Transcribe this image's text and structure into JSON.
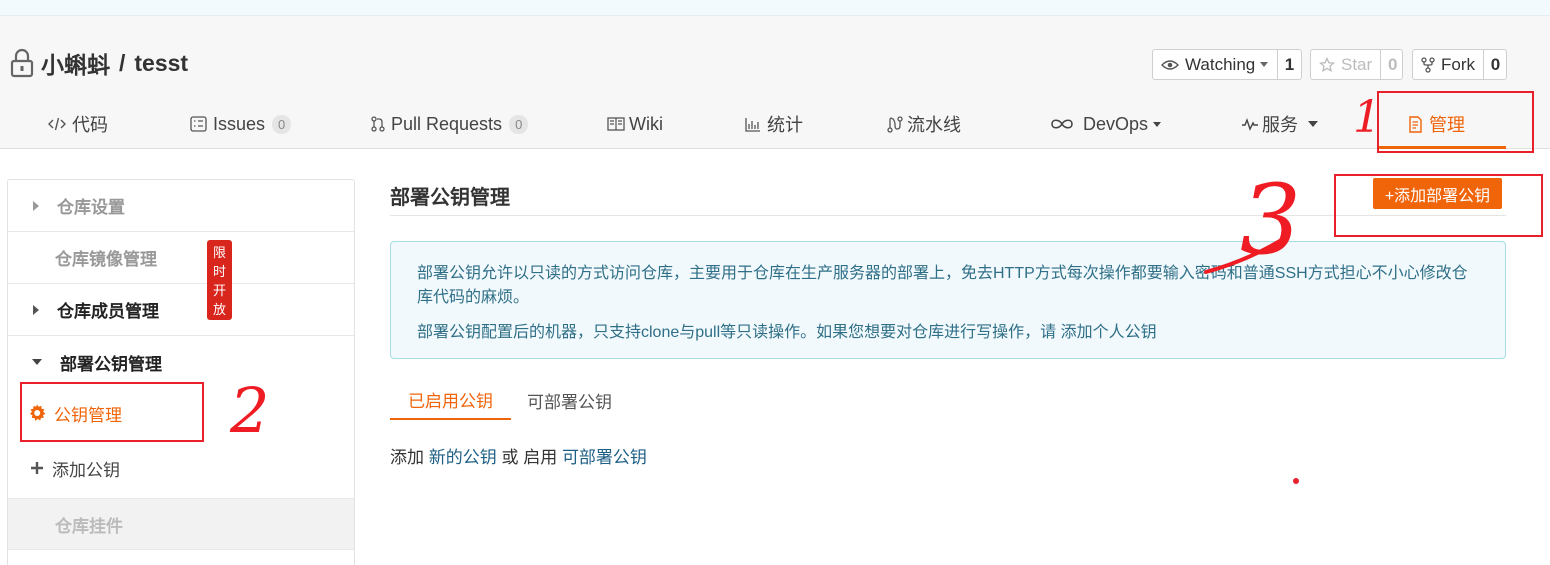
{
  "repo": {
    "owner": "小蝌蚪",
    "separator": "/",
    "name": "tesst"
  },
  "actions": {
    "watch": {
      "label": "Watching",
      "count": "1"
    },
    "star": {
      "label": "Star",
      "count": "0"
    },
    "fork": {
      "label": "Fork",
      "count": "0"
    }
  },
  "tabs": [
    {
      "label": "代码",
      "icon": "code-icon"
    },
    {
      "label": "Issues",
      "badge": "0",
      "icon": "issues-icon"
    },
    {
      "label": "Pull Requests",
      "badge": "0",
      "icon": "pull-request-icon"
    },
    {
      "label": "Wiki",
      "icon": "book-icon"
    },
    {
      "label": "统计",
      "icon": "bar-chart-icon"
    },
    {
      "label": "流水线",
      "icon": "pipeline-icon"
    },
    {
      "label": "DevOps",
      "icon": "infinity-icon"
    },
    {
      "label": "服务",
      "icon": "pulse-icon"
    },
    {
      "label": "管理",
      "icon": "manage-icon",
      "active": true
    }
  ],
  "sidebar": {
    "repo_settings": "仓库设置",
    "mirror_manage": "仓库镜像管理",
    "limit_badge": "限时开放",
    "member_manage": "仓库成员管理",
    "deploy_key_manage": "部署公钥管理",
    "key_manage": "公钥管理",
    "add_key": "添加公钥",
    "repo_plugins": "仓库挂件"
  },
  "main": {
    "title": "部署公钥管理",
    "add_button": "+添加部署公钥",
    "info_line1": "部署公钥允许以只读的方式访问仓库，主要用于仓库在生产服务器的部署上，免去HTTP方式每次操作都要输入密码和普通SSH方式担心不小心修改仓库代码的麻烦。",
    "info_line2": "部署公钥配置后的机器，只支持clone与pull等只读操作。如果您想要对仓库进行写操作，请 添加个人公钥",
    "subtabs": [
      "已启用公钥",
      "可部署公钥"
    ],
    "hint": {
      "add": "添加",
      "new_key": "新的公钥",
      "or": "或",
      "enable": "启用",
      "deployable": "可部署公钥"
    }
  },
  "annotations": [
    "1",
    "2",
    "3"
  ],
  "colors": {
    "accent": "#f0640a",
    "annotation_red": "#e8202a",
    "info_bg": "#f1f9fc",
    "link": "#1e5f86"
  }
}
